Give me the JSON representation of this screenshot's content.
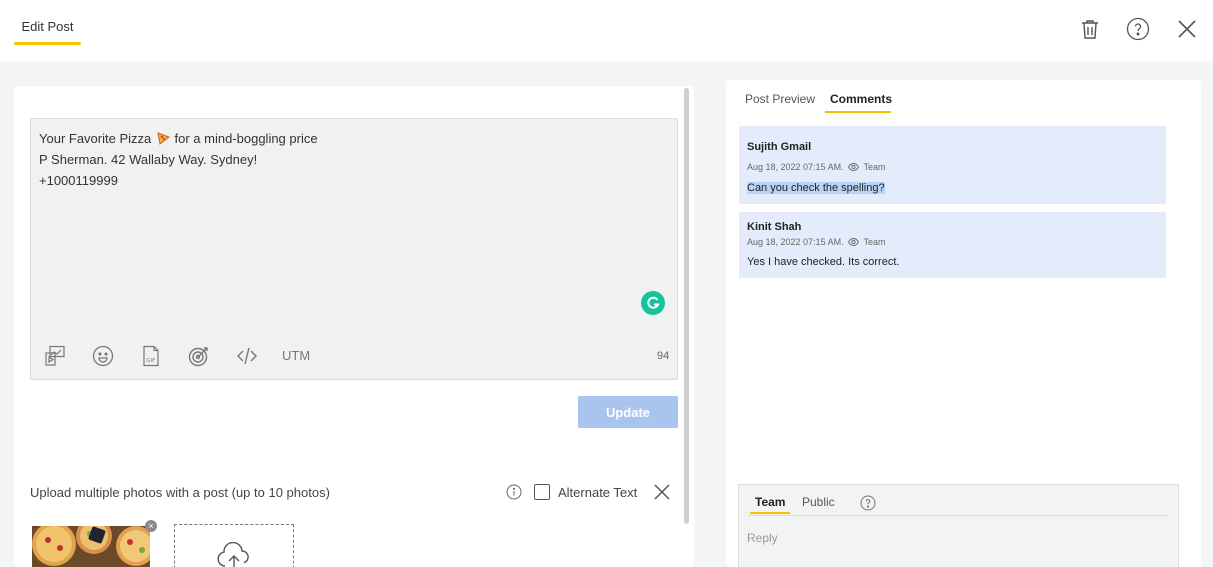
{
  "header": {
    "tab_label": "Edit Post",
    "icons": [
      "trash-icon",
      "help-icon",
      "close-icon"
    ]
  },
  "editor": {
    "lines": {
      "line1_before": "Your Favorite Pizza",
      "line1_after": "for a mind-boggling price",
      "line2": "P Sherman. 42 Wallaby Way. Sydney!",
      "line3": "+1000119999"
    },
    "toolbar": {
      "icons": [
        "media-icon",
        "emoji-icon",
        "gif-icon",
        "target-icon",
        "code-icon"
      ],
      "utm_label": "UTM"
    },
    "char_count": "94",
    "update_label": "Update"
  },
  "upload": {
    "label": "Upload multiple photos with a post (up to 10 photos)",
    "alt_text_label": "Alternate Text",
    "remove_glyph": "×"
  },
  "right_panel": {
    "tabs": [
      {
        "label": "Post Preview",
        "active": false
      },
      {
        "label": "Comments",
        "active": true
      }
    ],
    "comments": [
      {
        "author": "Sujith Gmail",
        "date": "Aug 18, 2022 07:15 AM.",
        "visibility": "Team",
        "text": "Can you check the spelling?"
      },
      {
        "author": "Kinit Shah",
        "date": "Aug 18, 2022 07:15 AM.",
        "visibility": "Team",
        "text": "Yes I have checked. Its correct."
      }
    ],
    "reply": {
      "tabs": [
        {
          "label": "Team",
          "active": true
        },
        {
          "label": "Public",
          "active": false
        }
      ],
      "placeholder": "Reply"
    }
  },
  "colors": {
    "accent": "#f2c500",
    "update_button": "#a9c4ef",
    "comment_bg": "#e4ecfb",
    "grammarly": "#15c39a"
  }
}
